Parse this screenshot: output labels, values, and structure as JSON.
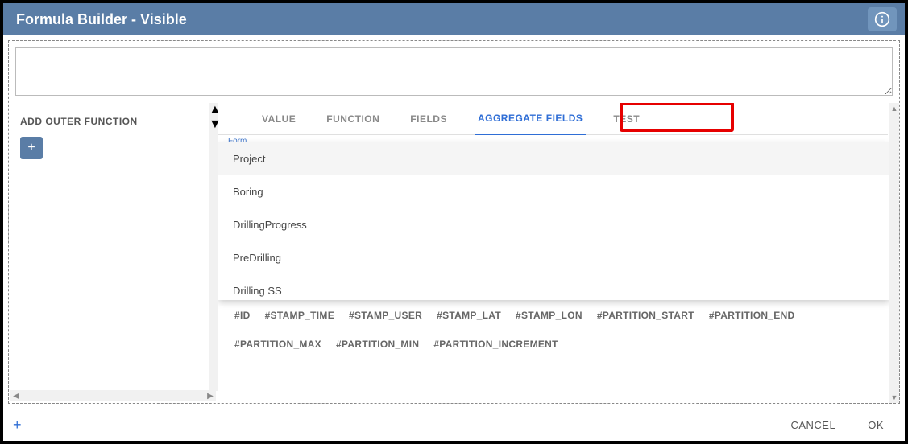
{
  "title": "Formula Builder - Visible",
  "left_panel": {
    "header": "ADD OUTER FUNCTION"
  },
  "tabs": {
    "value": "VALUE",
    "function": "FUNCTION",
    "fields": "FIELDS",
    "aggregate_fields": "AGGREGATE FIELDS",
    "test": "TEST"
  },
  "form_section_label": "Form",
  "dropdown": {
    "0": "Project",
    "1": "Boring",
    "2": "DrillingProgress",
    "3": "PreDrilling",
    "4": "Drilling SS"
  },
  "chips": {
    "0": "#ID",
    "1": "#STAMP_TIME",
    "2": "#STAMP_USER",
    "3": "#STAMP_LAT",
    "4": "#STAMP_LON",
    "5": "#PARTITION_START",
    "6": "#PARTITION_END",
    "7": "#PARTITION_MAX",
    "8": "#PARTITION_MIN",
    "9": "#PARTITION_INCREMENT"
  },
  "footer": {
    "cancel": "CANCEL",
    "ok": "OK"
  }
}
